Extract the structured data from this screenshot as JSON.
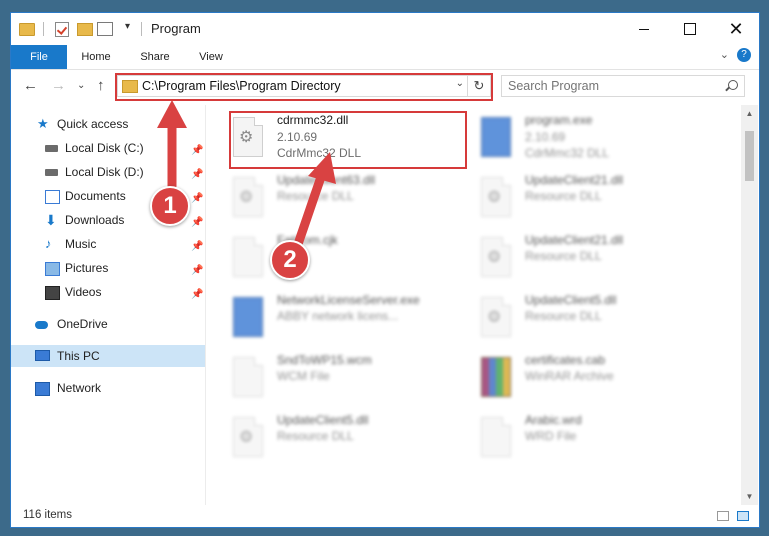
{
  "window": {
    "title": "Program"
  },
  "ribbon": {
    "tabs": [
      {
        "label": "File"
      },
      {
        "label": "Home"
      },
      {
        "label": "Share"
      },
      {
        "label": "View"
      }
    ]
  },
  "address": {
    "path": "C:\\Program Files\\Program Directory"
  },
  "search": {
    "placeholder": "Search Program"
  },
  "nav": {
    "items": [
      {
        "label": "Quick access",
        "icon": "star-icon"
      },
      {
        "label": "Local Disk (C:)",
        "icon": "disk-icon",
        "pinned": true
      },
      {
        "label": "Local Disk (D:)",
        "icon": "disk-icon",
        "pinned": true
      },
      {
        "label": "Documents",
        "icon": "document-icon",
        "pinned": true
      },
      {
        "label": "Downloads",
        "icon": "download-icon",
        "pinned": true
      },
      {
        "label": "Music",
        "icon": "music-icon",
        "pinned": true
      },
      {
        "label": "Pictures",
        "icon": "pictures-icon",
        "pinned": true
      },
      {
        "label": "Videos",
        "icon": "videos-icon",
        "pinned": true
      },
      {
        "label": "OneDrive",
        "icon": "cloud-icon"
      },
      {
        "label": "This PC",
        "icon": "computer-icon",
        "selected": true
      },
      {
        "label": "Network",
        "icon": "network-icon"
      }
    ]
  },
  "files": [
    {
      "name": "cdrmmc32.dll",
      "version": "2.10.69",
      "desc": "CdrMmc32 DLL",
      "icon": "dll-gear-icon"
    },
    {
      "name": "program.exe",
      "version": "2.10.69",
      "desc": "CdrMmc32 DLL",
      "icon": "exe-icon"
    },
    {
      "name": "UpdateClient63.dll",
      "version": "",
      "desc": "Resource DLL",
      "icon": "dll-gear-icon"
    },
    {
      "name": "UpdateClient21.dll",
      "version": "",
      "desc": "Resource DLL",
      "icon": "dll-gear-icon"
    },
    {
      "name": "FatCom.cjk",
      "version": "",
      "desc": "",
      "icon": "file-icon"
    },
    {
      "name": "UpdateClient21.dll",
      "version": "",
      "desc": "Resource DLL",
      "icon": "dll-gear-icon"
    },
    {
      "name": "NetworkLicenseServer.exe",
      "version": "",
      "desc": "ABBY network licens...",
      "icon": "exe-icon"
    },
    {
      "name": "UpdateClient5.dll",
      "version": "",
      "desc": "Resource DLL",
      "icon": "dll-gear-icon"
    },
    {
      "name": "SndToWP15.wcm",
      "version": "",
      "desc": "WCM File",
      "icon": "file-icon"
    },
    {
      "name": "certificates.cab",
      "version": "",
      "desc": "WinRAR Archive",
      "icon": "archive-icon"
    },
    {
      "name": "UpdateClient5.dll",
      "version": "",
      "desc": "Resource DLL",
      "icon": "dll-gear-icon"
    },
    {
      "name": "Arabic.wrd",
      "version": "",
      "desc": "WRD File",
      "icon": "file-icon"
    }
  ],
  "status": {
    "count": "116 items"
  },
  "annotations": [
    {
      "label": "1"
    },
    {
      "label": "2"
    }
  ],
  "colors": {
    "accent": "#1979ca",
    "annotation": "#d94242",
    "selection": "#cce4f7"
  }
}
